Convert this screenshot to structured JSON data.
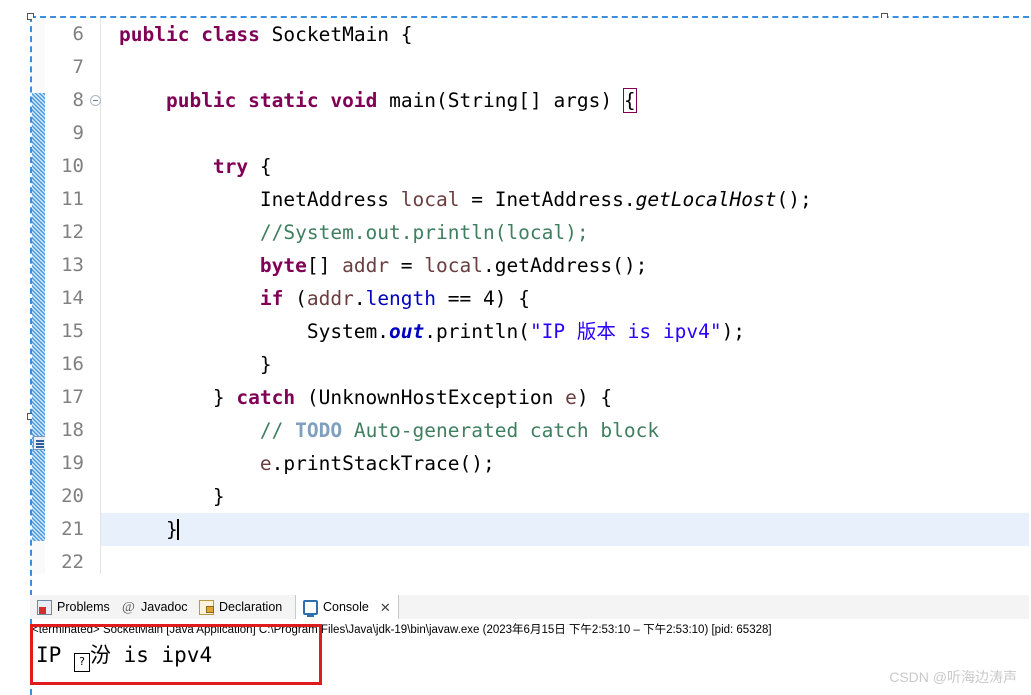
{
  "editor": {
    "first_line_number": 6,
    "current_line_number": 21,
    "lines": [
      {
        "num": "6",
        "text": "public class SocketMain {"
      },
      {
        "num": "7",
        "text": ""
      },
      {
        "num": "8",
        "text": "    public static void main(String[] args) {",
        "fold": true
      },
      {
        "num": "9",
        "text": ""
      },
      {
        "num": "10",
        "text": "        try {"
      },
      {
        "num": "11",
        "text": "            InetAddress local = InetAddress.getLocalHost();"
      },
      {
        "num": "12",
        "text": "            //System.out.println(local);"
      },
      {
        "num": "13",
        "text": "            byte[] addr = local.getAddress();"
      },
      {
        "num": "14",
        "text": "            if (addr.length == 4) {"
      },
      {
        "num": "15",
        "text": "                System.out.println(\"IP 版本 is ipv4\");"
      },
      {
        "num": "16",
        "text": "            }"
      },
      {
        "num": "17",
        "text": "        } catch (UnknownHostException e) {"
      },
      {
        "num": "18",
        "text": "            // TODO Auto-generated catch block",
        "marker": "todo-task-marker"
      },
      {
        "num": "19",
        "text": "            e.printStackTrace();"
      },
      {
        "num": "20",
        "text": "        }"
      },
      {
        "num": "21",
        "text": "    }",
        "current": true
      },
      {
        "num": "22",
        "text": ""
      }
    ]
  },
  "tabs": [
    {
      "label": "Problems",
      "icon": "problems-icon",
      "active": false,
      "closable": false
    },
    {
      "label": "Javadoc",
      "icon": "javadoc-icon",
      "active": false,
      "closable": false
    },
    {
      "label": "Declaration",
      "icon": "declaration-icon",
      "active": false,
      "closable": false
    },
    {
      "label": "Console",
      "icon": "console-icon",
      "active": true,
      "closable": true,
      "close_glyph": "✕"
    }
  ],
  "console": {
    "terminated_line": "<terminated> SocketMain [Java Application] C:\\Program Files\\Java\\jdk-19\\bin\\javaw.exe  (2023年6月15日 下午2:53:10 – 下午2:53:10) [pid: 65328]",
    "output_prefix": "IP ",
    "output_boxglyph": "?",
    "output_suffix": "汾 is ipv4"
  },
  "watermark": {
    "text": "CSDN @听海边涛声"
  },
  "colors": {
    "keyword": "#7f0055",
    "comment": "#3f7f5f",
    "todo": "#7f9fbf",
    "string": "#2a00ff",
    "field_static": "#0000c0",
    "local_var": "#6a3e3e",
    "current_line_bg": "#e8f0fb",
    "annotation_bar": "#4e9ce0",
    "selection_dash": "#3b8ede",
    "highlight_box": "#e01b1b",
    "watermark": "#c9c9c9"
  }
}
